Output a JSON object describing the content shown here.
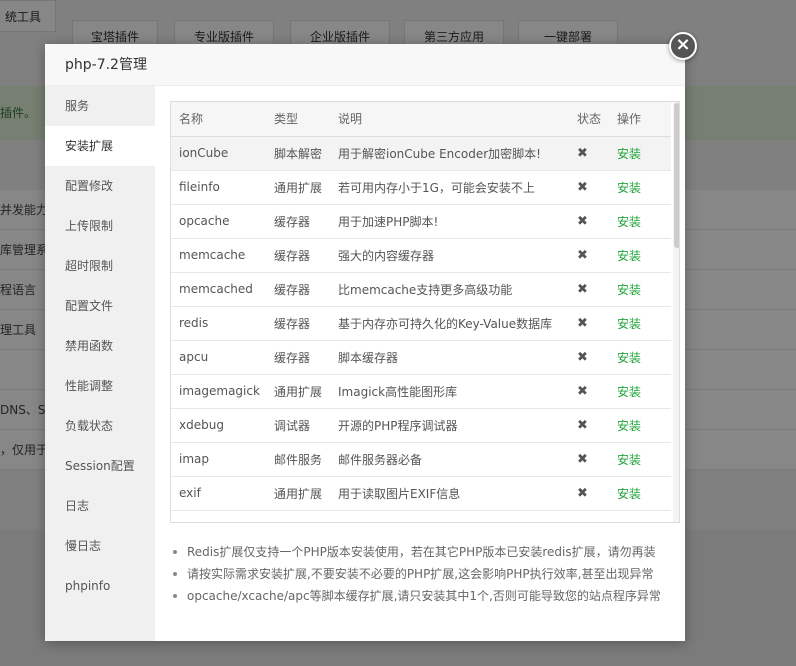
{
  "background": {
    "tabs": [
      "统工具",
      "宝塔插件",
      "专业版插件",
      "企业版插件",
      "第三方应用",
      "一键部署"
    ],
    "notice": "插件。",
    "rows": [
      "并发能力",
      "库管理系",
      "程语言",
      "理工具",
      "",
      "DNS、Sw",
      "，仅用于"
    ]
  },
  "modal": {
    "title": "php-7.2管理",
    "close_label": "×",
    "sidebar": [
      "服务",
      "安装扩展",
      "配置修改",
      "上传限制",
      "超时限制",
      "配置文件",
      "禁用函数",
      "性能调整",
      "负载状态",
      "Session配置",
      "日志",
      "慢日志",
      "phpinfo"
    ],
    "active_index": 1,
    "table": {
      "headers": [
        "名称",
        "类型",
        "说明",
        "状态",
        "操作"
      ],
      "rows": [
        {
          "name": "ionCube",
          "type": "脚本解密",
          "desc": "用于解密ionCube Encoder加密脚本!",
          "status": "✖",
          "action": "安装"
        },
        {
          "name": "fileinfo",
          "type": "通用扩展",
          "desc": "若可用内存小于1G，可能会安装不上",
          "status": "✖",
          "action": "安装"
        },
        {
          "name": "opcache",
          "type": "缓存器",
          "desc": "用于加速PHP脚本!",
          "status": "✖",
          "action": "安装"
        },
        {
          "name": "memcache",
          "type": "缓存器",
          "desc": "强大的内容缓存器",
          "status": "✖",
          "action": "安装"
        },
        {
          "name": "memcached",
          "type": "缓存器",
          "desc": "比memcache支持更多高级功能",
          "status": "✖",
          "action": "安装"
        },
        {
          "name": "redis",
          "type": "缓存器",
          "desc": "基于内存亦可持久化的Key-Value数据库",
          "status": "✖",
          "action": "安装"
        },
        {
          "name": "apcu",
          "type": "缓存器",
          "desc": "脚本缓存器",
          "status": "✖",
          "action": "安装"
        },
        {
          "name": "imagemagick",
          "type": "通用扩展",
          "desc": "Imagick高性能图形库",
          "status": "✖",
          "action": "安装"
        },
        {
          "name": "xdebug",
          "type": "调试器",
          "desc": "开源的PHP程序调试器",
          "status": "✖",
          "action": "安装"
        },
        {
          "name": "imap",
          "type": "邮件服务",
          "desc": "邮件服务器必备",
          "status": "✖",
          "action": "安装"
        },
        {
          "name": "exif",
          "type": "通用扩展",
          "desc": "用于读取图片EXIF信息",
          "status": "✖",
          "action": "安装"
        }
      ]
    },
    "notes": [
      "Redis扩展仅支持一个PHP版本安装使用，若在其它PHP版本已安装redis扩展，请勿再装",
      "请按实际需求安装扩展,不要安装不必要的PHP扩展,这会影响PHP执行效率,甚至出现异常",
      "opcache/xcache/apc等脚本缓存扩展,请只安装其中1个,否则可能导致您的站点程序异常"
    ]
  }
}
